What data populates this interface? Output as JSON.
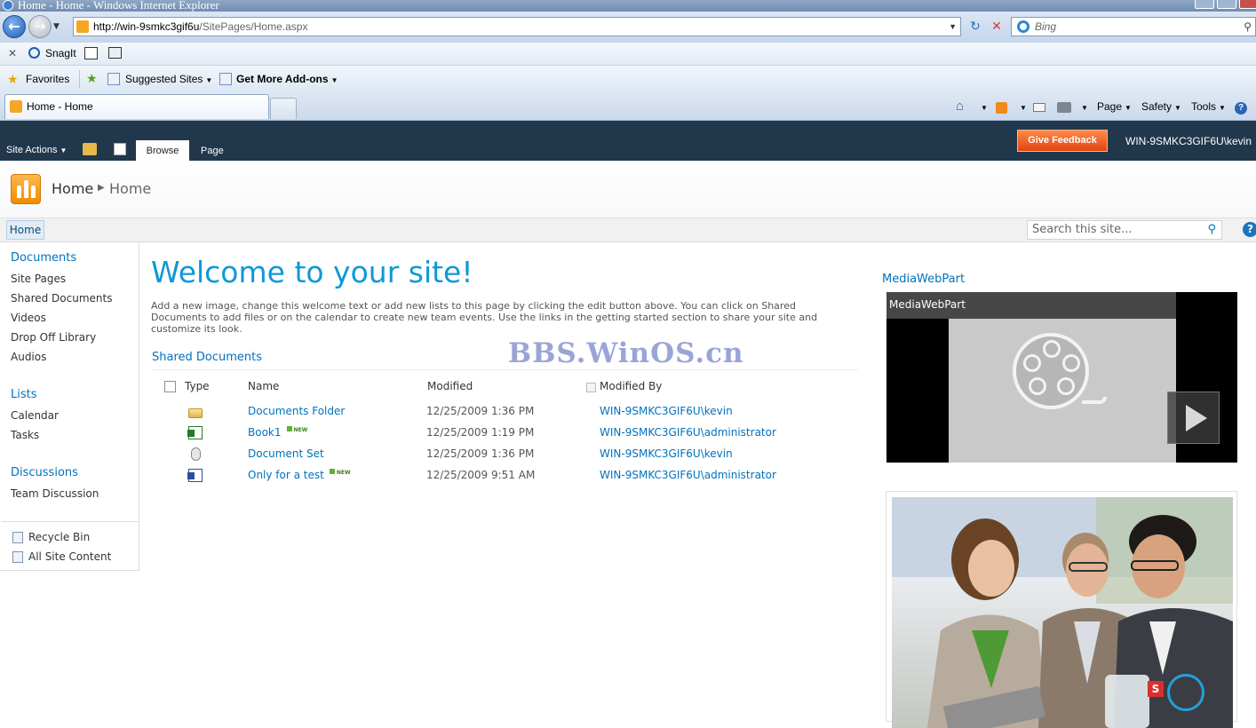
{
  "window": {
    "title": "Home - Home - Windows Internet Explorer"
  },
  "address": {
    "url_host": "http://win-9smkc3gif6u",
    "url_path": "/SitePages/Home.aspx",
    "search_placeholder": "Bing"
  },
  "links_bar": {
    "snagit": "SnagIt"
  },
  "favorites_bar": {
    "favorites": "Favorites",
    "suggested": "Suggested Sites",
    "addons": "Get More Add-ons"
  },
  "tabs": {
    "active": "Home - Home"
  },
  "command_bar": {
    "page": "Page",
    "safety": "Safety",
    "tools": "Tools"
  },
  "ribbon": {
    "site_actions": "Site Actions",
    "browse": "Browse",
    "page": "Page",
    "feedback": "Give Feedback",
    "user": "WIN-9SMKC3GIF6U\\kevin"
  },
  "breadcrumb": {
    "site": "Home",
    "page": "Home"
  },
  "topnav": {
    "home": "Home",
    "search_placeholder": "Search this site..."
  },
  "leftnav": {
    "documents": "Documents",
    "documents_items": [
      "Site Pages",
      "Shared Documents",
      "Videos",
      "Drop Off Library",
      "Audios"
    ],
    "lists": "Lists",
    "lists_items": [
      "Calendar",
      "Tasks"
    ],
    "discussions": "Discussions",
    "discussions_items": [
      "Team Discussion"
    ],
    "recycle": "Recycle Bin",
    "all_content": "All Site Content"
  },
  "main": {
    "welcome_title": "Welcome to your site!",
    "welcome_body": "Add a new image, change this welcome text or add new lists to this page by clicking the edit button above. You can click on Shared Documents to add files or on the calendar to create new team events. Use the links in the getting started section to share your site and customize its look.",
    "shared_docs_title": "Shared Documents",
    "columns": {
      "type": "Type",
      "name": "Name",
      "modified": "Modified",
      "modified_by": "Modified By"
    },
    "rows": [
      {
        "type_icon": "folder-icon",
        "name": "Documents Folder",
        "new": "",
        "modified": "12/25/2009 1:36 PM",
        "modified_by": "WIN-9SMKC3GIF6U\\kevin"
      },
      {
        "type_icon": "excel-icon",
        "name": "Book1",
        "new": "NEW",
        "modified": "12/25/2009 1:19 PM",
        "modified_by": "WIN-9SMKC3GIF6U\\administrator"
      },
      {
        "type_icon": "document-set-icon",
        "name": "Document Set",
        "new": "",
        "modified": "12/25/2009 1:36 PM",
        "modified_by": "WIN-9SMKC3GIF6U\\kevin"
      },
      {
        "type_icon": "word-icon",
        "name": "Only for a test",
        "new": "NEW",
        "modified": "12/25/2009 9:51 AM",
        "modified_by": "WIN-9SMKC3GIF6U\\administrator"
      }
    ],
    "watermark": "BBS.WinOS.cn"
  },
  "media": {
    "title": "MediaWebPart",
    "caption": "MediaWebPart"
  },
  "colors": {
    "ribbon": "#21374c",
    "link": "#0072bc",
    "welcome": "#0f98d8",
    "feedback": "#e04410"
  }
}
